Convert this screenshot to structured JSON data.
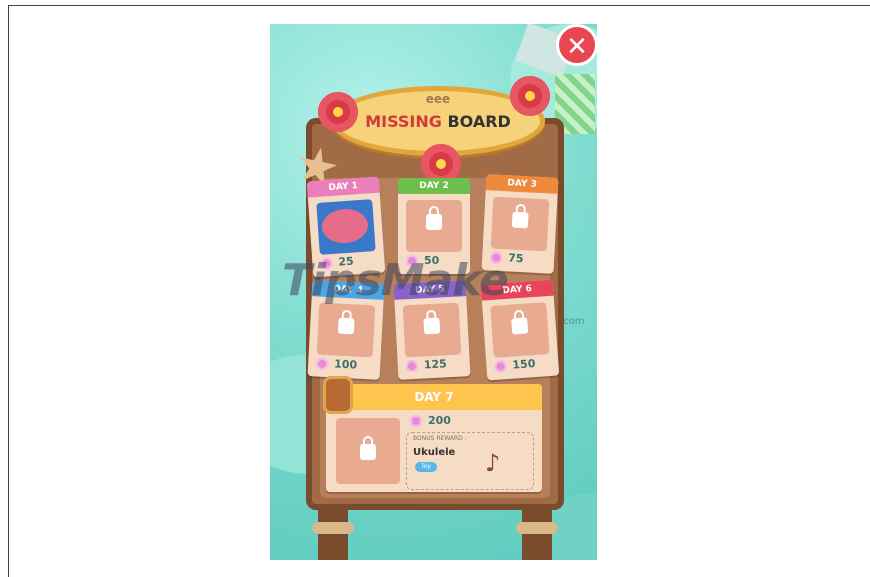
{
  "close_symbol": "✕",
  "sign": {
    "decoration": "eee",
    "title_red": "MISSING",
    "title_dark": " BOARD"
  },
  "days": [
    {
      "label": "DAY 1",
      "value": "25",
      "color": "#ea7fba",
      "locked": false
    },
    {
      "label": "DAY 2",
      "value": "50",
      "color": "#6fbe4d",
      "locked": true
    },
    {
      "label": "DAY 3",
      "value": "75",
      "color": "#ef8a3c",
      "locked": true
    },
    {
      "label": "DAY 4",
      "value": "100",
      "color": "#4ba6e6",
      "locked": true
    },
    {
      "label": "DAY 5",
      "value": "125",
      "color": "#8a62c9",
      "locked": true
    },
    {
      "label": "DAY 6",
      "value": "150",
      "color": "#e9455a",
      "locked": true
    }
  ],
  "day7": {
    "label": "DAY 7",
    "value": "200",
    "bonus_title": "BONUS REWARD :",
    "bonus_name": "Ukulele",
    "bonus_tag": "Toy"
  },
  "watermark": {
    "main": "TipsMake",
    "sub": ".com"
  },
  "colors": {
    "accent_close": "#e8474f",
    "shell": "#e88bd6",
    "board": "#a06b45"
  }
}
